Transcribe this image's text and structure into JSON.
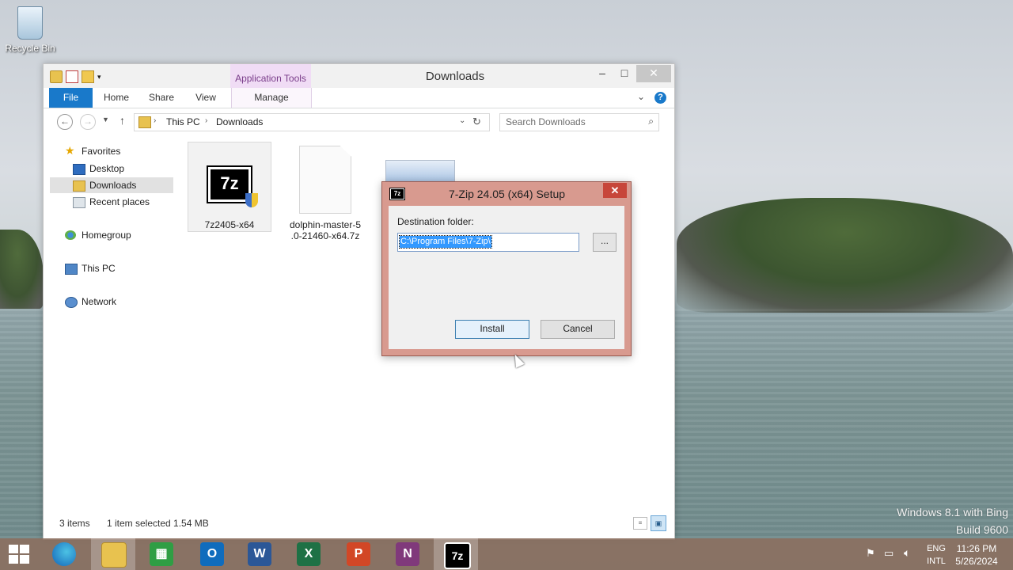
{
  "desktop": {
    "recycle_bin_label": "Recycle Bin",
    "watermark_line1": "Windows 8.1 with Bing",
    "watermark_line2": "Build 9600"
  },
  "explorer": {
    "title": "Downloads",
    "contextual_tab_group": "Application Tools",
    "ribbon_tabs": {
      "file": "File",
      "home": "Home",
      "share": "Share",
      "view": "View",
      "manage": "Manage"
    },
    "address": {
      "crumbs": [
        "This PC",
        "Downloads"
      ]
    },
    "search_placeholder": "Search Downloads",
    "nav_pane": {
      "favorites": "Favorites",
      "desktop": "Desktop",
      "downloads": "Downloads",
      "recent_places": "Recent places",
      "homegroup": "Homegroup",
      "this_pc": "This PC",
      "network": "Network"
    },
    "files": [
      {
        "name": "7z2405-x64",
        "icon": "7zip-installer-icon",
        "selected": true
      },
      {
        "name_line1": "dolphin-master-5",
        "name_line2": ".0-21460-x64.7z",
        "icon": "archive-file-icon",
        "selected": false
      }
    ],
    "status": {
      "item_count": "3 items",
      "selection": "1 item selected  1.54 MB"
    }
  },
  "dialog": {
    "title": "7-Zip 24.05 (x64) Setup",
    "dest_label": "Destination folder:",
    "dest_value": "C:\\Program Files\\7-Zip\\",
    "browse_label": "...",
    "install_label": "Install",
    "cancel_label": "Cancel",
    "close_label": "✕"
  },
  "taskbar": {
    "apps": [
      "File Explorer",
      "Edge",
      "Store",
      "Outlook",
      "Word",
      "Excel",
      "PowerPoint",
      "OneNote",
      "7-Zip"
    ],
    "lang_line1": "ENG",
    "lang_line2": "INTL",
    "time": "11:26 PM",
    "date": "5/26/2024"
  },
  "colors": {
    "file_tab": "#1979ca",
    "dialog_frame": "#d89a8f",
    "taskbar": "#8c6e5f",
    "selection": "#3399ff"
  }
}
